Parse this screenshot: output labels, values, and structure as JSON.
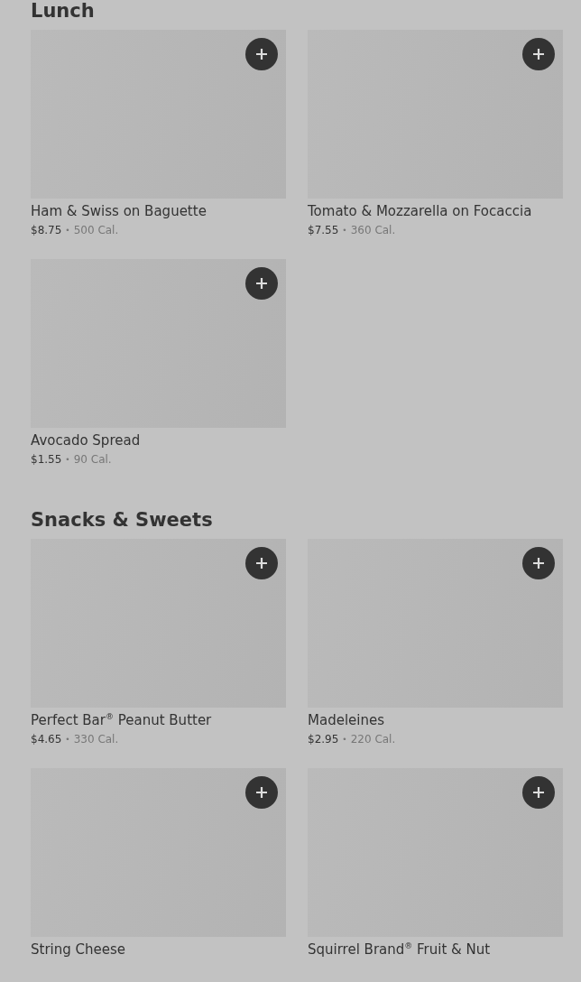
{
  "sections": [
    {
      "title": "Lunch",
      "items": [
        {
          "name": "Ham & Swiss on Baguette",
          "price": "$8.75",
          "separator": "•",
          "calories": "500 Cal."
        },
        {
          "name": "Tomato & Mozzarella on Focaccia",
          "price": "$7.55",
          "separator": "•",
          "calories": "360 Cal."
        },
        {
          "name": "Avocado Spread",
          "price": "$1.55",
          "separator": "•",
          "calories": "90 Cal."
        }
      ]
    },
    {
      "title": "Snacks & Sweets",
      "items": [
        {
          "name": "Perfect Bar$^{®}$ Peanut Butter",
          "price": "$4.65",
          "separator": "•",
          "calories": "330 Cal."
        },
        {
          "name": "Madeleines",
          "price": "$2.95",
          "separator": "•",
          "calories": "220 Cal."
        },
        {
          "name": "String Cheese"
        },
        {
          "name": "Squirrel Brand$^{®}$ Fruit & Nut"
        }
      ]
    }
  ]
}
